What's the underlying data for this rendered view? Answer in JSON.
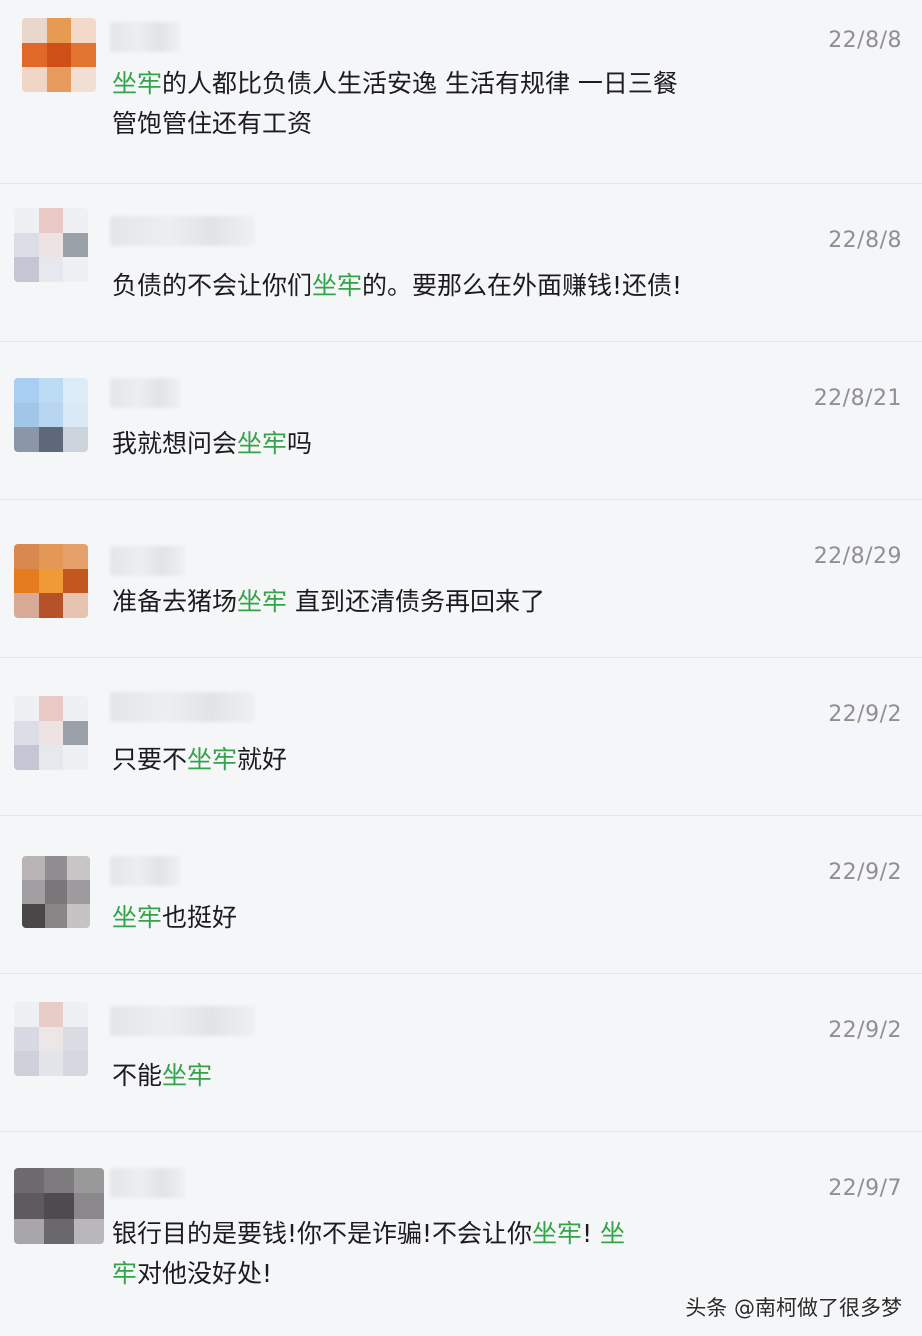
{
  "colors": {
    "background": "#f5f6f8",
    "text": "#1c1c1e",
    "highlight": "#35a34a",
    "date": "#8f8f94"
  },
  "comments": [
    {
      "date": "22/8/8",
      "segments": [
        {
          "t": "坐牢",
          "hl": true
        },
        {
          "t": "的人都比负债人生活安逸 生活有规律 一日三餐",
          "hl": false
        },
        {
          "t": "管饱管住还有工资",
          "hl": false,
          "br": true
        }
      ],
      "avatar_colors": [
        "#ead7cb",
        "#e79a52",
        "#f3d9c9",
        "#e0692a",
        "#cf5016",
        "#e2752f",
        "#efd6c7",
        "#e79a5d",
        "#f2dfd3"
      ]
    },
    {
      "date": "22/8/8",
      "segments": [
        {
          "t": "负债的不会让你们",
          "hl": false
        },
        {
          "t": "坐牢",
          "hl": true
        },
        {
          "t": "的。要那么在外面赚钱!还债!",
          "hl": false
        }
      ],
      "avatar_colors": [
        "#eef0f3",
        "#e9c9c5",
        "#eef0f3",
        "#dcdde6",
        "#eee3e3",
        "#9aa0a8",
        "#c4c7d3",
        "#e7e8ee",
        "#eef0f3"
      ]
    },
    {
      "date": "22/8/21",
      "segments": [
        {
          "t": "我就想问会",
          "hl": false
        },
        {
          "t": "坐牢",
          "hl": true
        },
        {
          "t": "吗",
          "hl": false
        }
      ],
      "avatar_colors": [
        "#a8cff2",
        "#bcdcf6",
        "#dcebf8",
        "#a2c6e8",
        "#b8d6f0",
        "#dbe9f6",
        "#8b96a6",
        "#5e6878",
        "#cdd3dd"
      ]
    },
    {
      "date": "22/8/29",
      "segments": [
        {
          "t": "准备去猪场",
          "hl": false
        },
        {
          "t": "坐牢",
          "hl": true
        },
        {
          "t": " 直到还清债务再回来了",
          "hl": false
        }
      ],
      "avatar_colors": [
        "#d9884f",
        "#e39855",
        "#e6a06a",
        "#e47c1e",
        "#f09a35",
        "#c2581f",
        "#d8aa95",
        "#b5522a",
        "#e7c3b2"
      ]
    },
    {
      "date": "22/9/2",
      "segments": [
        {
          "t": "只要不",
          "hl": false
        },
        {
          "t": "坐牢",
          "hl": true
        },
        {
          "t": "就好",
          "hl": false
        }
      ],
      "avatar_colors": [
        "#eef0f3",
        "#e9c9c5",
        "#eef0f3",
        "#dcdde6",
        "#eee3e3",
        "#9aa0a8",
        "#c4c7d3",
        "#e7e8ee",
        "#eef0f3"
      ]
    },
    {
      "date": "22/9/2",
      "segments": [
        {
          "t": "坐牢",
          "hl": true
        },
        {
          "t": "也挺好",
          "hl": false
        }
      ],
      "avatar_colors": [
        "#b8b4b6",
        "#8f8d90",
        "#c8c5c7",
        "#a19fa1",
        "#7a7679",
        "#9e9b9e",
        "#4a4749",
        "#8a8688",
        "#c6c3c5"
      ]
    },
    {
      "date": "22/9/2",
      "segments": [
        {
          "t": "不能",
          "hl": false
        },
        {
          "t": "坐牢",
          "hl": true
        }
      ],
      "avatar_colors": [
        "#eef0f3",
        "#e8ccc8",
        "#eef0f3",
        "#d8d9e2",
        "#ece6e7",
        "#dadbe3",
        "#cfd1da",
        "#e4e5eb",
        "#d6d8df"
      ]
    },
    {
      "date": "22/9/7",
      "segments": [
        {
          "t": "银行目的是要钱!你不是诈骗!不会让你",
          "hl": false
        },
        {
          "t": "坐牢",
          "hl": true
        },
        {
          "t": "! ",
          "hl": false
        },
        {
          "t": "坐",
          "hl": true
        },
        {
          "t": "牢",
          "hl": true,
          "br": true
        },
        {
          "t": "对他没好处!",
          "hl": false
        }
      ],
      "avatar_colors": [
        "#6d6b6d",
        "#7d7b7d",
        "#9a999a",
        "#5d5b5e",
        "#4d4b4e",
        "#8a888a",
        "#a8a6a8",
        "#6a686b",
        "#b9b7b9"
      ]
    }
  ],
  "watermark": "头条 @南柯做了很多梦"
}
